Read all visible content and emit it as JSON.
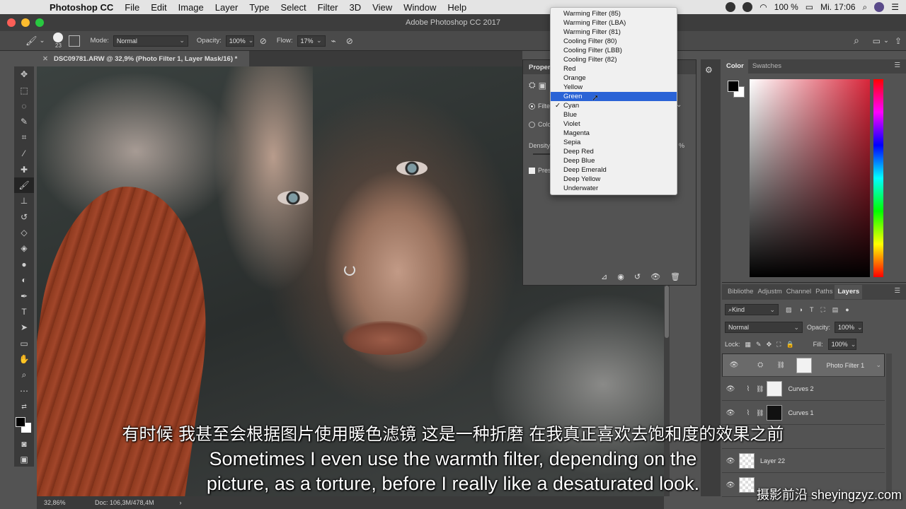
{
  "menubar": {
    "app_name": "Photoshop CC",
    "items": [
      "File",
      "Edit",
      "Image",
      "Layer",
      "Type",
      "Select",
      "Filter",
      "3D",
      "View",
      "Window",
      "Help"
    ],
    "battery": "100 %",
    "clock": "Mi. 17:06"
  },
  "window": {
    "title": "Adobe Photoshop CC 2017"
  },
  "options": {
    "brush_size": "23",
    "mode_label": "Mode:",
    "mode_value": "Normal",
    "opacity_label": "Opacity:",
    "opacity_value": "100%",
    "flow_label": "Flow:",
    "flow_value": "17%"
  },
  "document": {
    "tab_title": "DSC09781.ARW @ 32,9% (Photo Filter 1, Layer Mask/16) *"
  },
  "status": {
    "zoom": "32,86%",
    "doc_size": "Doc: 106,3M/478,4M"
  },
  "properties": {
    "title": "Proper",
    "filter_label": "Filte",
    "color_label": "Colo",
    "density_label": "Density",
    "density_pct": "%",
    "preserve_label": "Pres"
  },
  "filter_dropdown": {
    "items": [
      "Warming Filter (85)",
      "Warming Filter (LBA)",
      "Warming Filter (81)",
      "Cooling Filter (80)",
      "Cooling Filter (LBB)",
      "Cooling Filter (82)",
      "Red",
      "Orange",
      "Yellow",
      "Green",
      "Cyan",
      "Blue",
      "Violet",
      "Magenta",
      "Sepia",
      "Deep Red",
      "Deep Blue",
      "Deep Emerald",
      "Deep Yellow",
      "Underwater"
    ],
    "highlighted": "Green",
    "checked": "Cyan"
  },
  "color_panel": {
    "tab_color": "Color",
    "tab_swatches": "Swatches"
  },
  "layers_panel": {
    "tabs": [
      "Bibliothe",
      "Adjustm",
      "Channel",
      "Paths",
      "Layers"
    ],
    "kind_label": "Kind",
    "blend_mode": "Normal",
    "opacity_label": "Opacity:",
    "opacity_value": "100%",
    "lock_label": "Lock:",
    "fill_label": "Fill:",
    "fill_value": "100%",
    "layers": [
      {
        "name": "Photo Filter 1"
      },
      {
        "name": "Curves 2"
      },
      {
        "name": "Curves 1"
      },
      {
        "name": "Layer 22"
      }
    ]
  },
  "subtitles": {
    "chinese": "有时候 我甚至会根据图片使用暖色滤镜 这是一种折磨 在我真正喜欢去饱和度的效果之前",
    "english_line1": "Sometimes I even use the warmth filter, depending on the",
    "english_line2": "picture, as a torture, before I really like a desaturated look."
  },
  "watermark": "摄影前沿 sheyingzyz.com"
}
